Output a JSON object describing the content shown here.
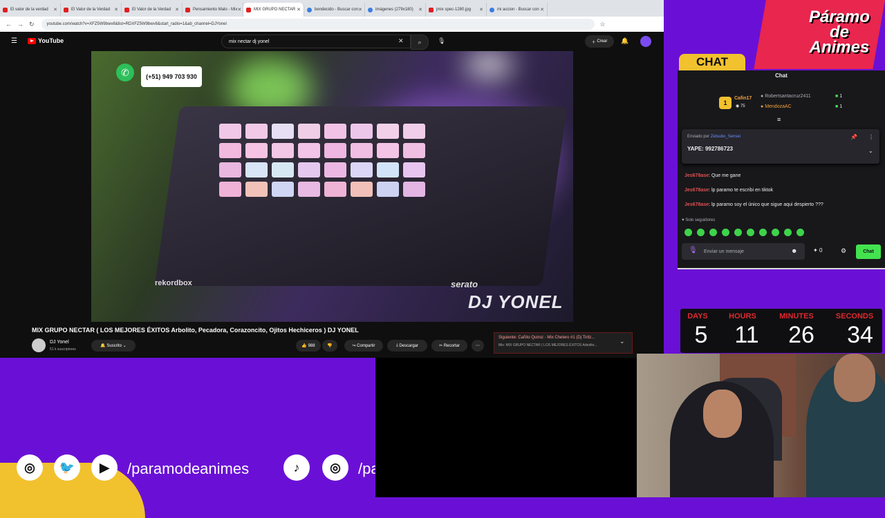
{
  "browser": {
    "tabs": [
      {
        "title": "El valor de la verdad"
      },
      {
        "title": "El Valor de la Verdad"
      },
      {
        "title": "El Valor de la Verdad"
      },
      {
        "title": "Pensamiento Malo - Mix"
      },
      {
        "title": "MIX GRUPO NECTAR",
        "active": true
      },
      {
        "title": "bendecido - Buscar con"
      },
      {
        "title": "imágenes (279x180)"
      },
      {
        "title": "jmix spec-1280.jpg"
      },
      {
        "title": "mi accion - Buscar con"
      }
    ],
    "url": "youtube.com/watch?v=XFZ5W9bwv8&list=RDXFZ5W9bwv8&start_radio=1&ab_channel=DJYonel"
  },
  "youtube": {
    "logo": "YouTube",
    "search_value": "mix nectar dj yonel",
    "create_label": "Crear",
    "video": {
      "whatsapp_number": "(+51) 949 703 930",
      "watermark": "DJ YONEL",
      "brand_left": "rekordbox",
      "brand_right": "serato"
    },
    "title": "MIX GRUPO NECTAR ( LOS MEJORES ÉXITOS Arbolito, Pecadora, Corazoncito, Ojitos Hechiceros ) DJ YONEL",
    "channel": "DJ Yonel",
    "subscribers": "51 k suscriptores",
    "subscribed_label": "Suscrito",
    "likes": "988",
    "share_label": "Compartir",
    "download_label": "Descargar",
    "clip_label": "Recortar",
    "next_label": "Siguiente: Cañito Quiroz - Mix Chelero #1 (Dj Tiritz...",
    "next_sub": "Mix: MIX GRUPO NECTAR ( LOS MEJORES ÉXITOS Arbolito..."
  },
  "overlay": {
    "logo_lines": [
      "Páramo",
      "de",
      "Animes"
    ],
    "chat_tab": "CHAT",
    "social_handle": "/paramodeanimes",
    "social_handle_partial": "/pa"
  },
  "chat": {
    "header": "Chat",
    "leader_1": "Cafin17",
    "leader_1_points": "75",
    "leader_2": "Robertsantacruz2411",
    "leader_2_count": "1",
    "leader_3": "MendozaAC",
    "leader_3_count": "1",
    "pinned_by_label": "Enviado por",
    "pinned_by_user": "Zetsubo_Sensei",
    "pinned_message": "YAPE: 992786723",
    "messages": [
      {
        "user": "Jes678ase",
        "text": "Que me gane"
      },
      {
        "user": "Jes678ase",
        "text": "lp paramo te escribi en tiktok"
      },
      {
        "user": "Jes678ase",
        "text": "lp paramo soy el único que sigue aqui despierto ???"
      }
    ],
    "followers_only": "Solo seguidores",
    "input_placeholder": "Enviar un mensaje",
    "points": "0",
    "send_label": "Chat"
  },
  "countdown": {
    "days_label": "DAYS",
    "days": "5",
    "hours_label": "HOURS",
    "hours": "11",
    "minutes_label": "MINUTES",
    "minutes": "26",
    "seconds_label": "SECONDS",
    "seconds": "34"
  },
  "colors": {
    "overlay_bg": "#6a10d6",
    "brand_red": "#e8264e",
    "brand_yellow": "#f2c12e",
    "chat_send": "#43e34f",
    "countdown_label": "#e0292f"
  }
}
